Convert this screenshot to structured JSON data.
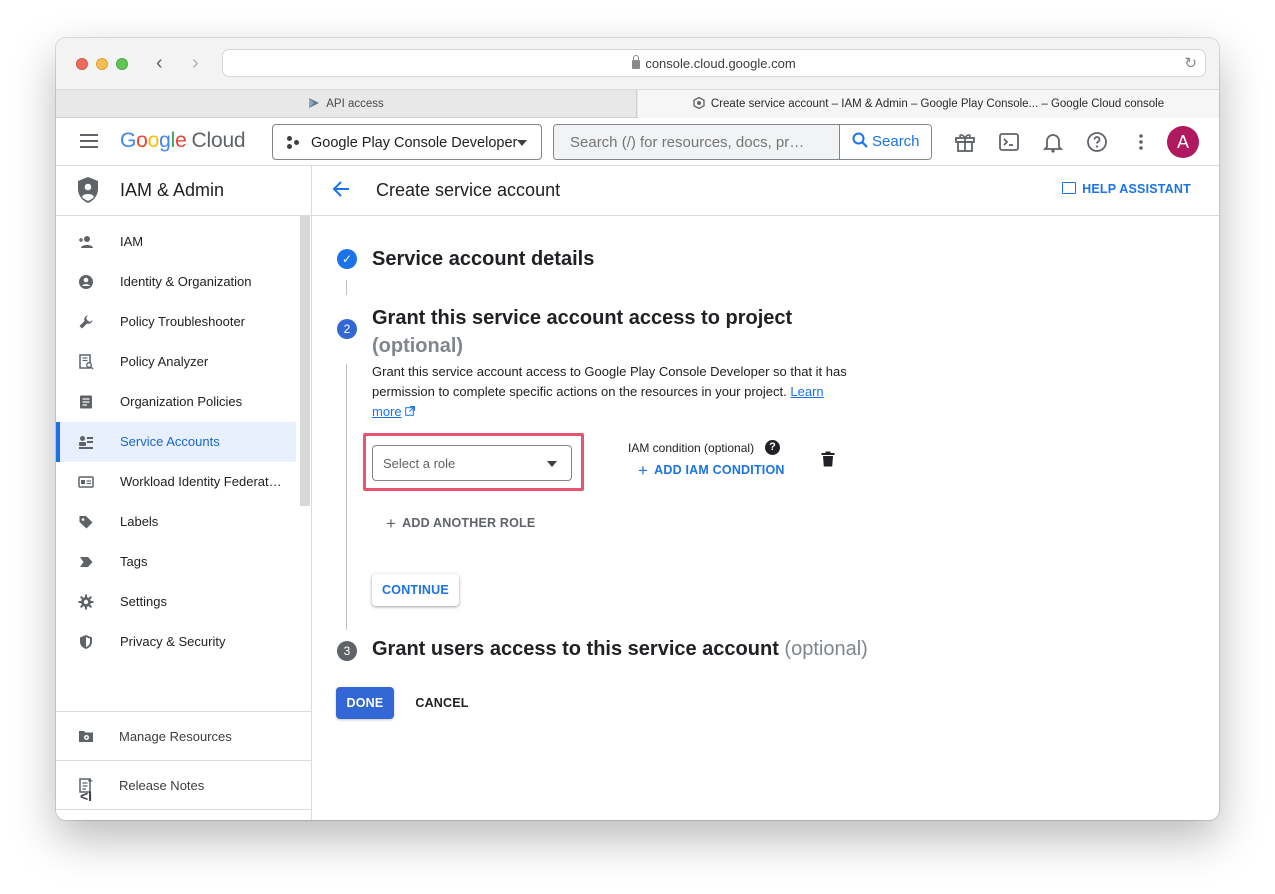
{
  "browser": {
    "url": "console.cloud.google.com",
    "tabs": [
      {
        "label": "API access"
      },
      {
        "label": "Create service account – IAM & Admin – Google Play Console... – Google Cloud console"
      }
    ]
  },
  "header": {
    "logo_google": [
      "G",
      "o",
      "o",
      "g",
      "l",
      "e"
    ],
    "logo_cloud": "Cloud",
    "project": "Google Play Console Developer",
    "search_placeholder": "Search (/) for resources, docs, pr…",
    "search_button": "Search",
    "avatar_initial": "A"
  },
  "sidebar": {
    "title": "IAM & Admin",
    "items": [
      {
        "label": "IAM",
        "icon": "person-add-icon"
      },
      {
        "label": "Identity & Organization",
        "icon": "account-circle-icon"
      },
      {
        "label": "Policy Troubleshooter",
        "icon": "wrench-icon"
      },
      {
        "label": "Policy Analyzer",
        "icon": "document-search-icon"
      },
      {
        "label": "Organization Policies",
        "icon": "list-document-icon"
      },
      {
        "label": "Service Accounts",
        "icon": "service-account-icon",
        "active": true
      },
      {
        "label": "Workload Identity Federat…",
        "icon": "id-card-icon"
      },
      {
        "label": "Labels",
        "icon": "label-icon"
      },
      {
        "label": "Tags",
        "icon": "tag-icon"
      },
      {
        "label": "Settings",
        "icon": "gear-icon"
      },
      {
        "label": "Privacy & Security",
        "icon": "shield-icon"
      }
    ],
    "footer": [
      {
        "label": "Manage Resources",
        "icon": "manage-resources-icon"
      },
      {
        "label": "Release Notes",
        "icon": "release-notes-icon"
      }
    ],
    "collapse_glyph": "<I"
  },
  "main": {
    "title": "Create service account",
    "help_assistant": "HELP ASSISTANT",
    "steps": [
      {
        "number": "✓",
        "title": "Service account details",
        "optional": ""
      },
      {
        "number": "2",
        "title": "Grant this service account access to project",
        "optional": "(optional)"
      },
      {
        "number": "3",
        "title": "Grant users access to this service account",
        "optional": "(optional)"
      }
    ],
    "description": "Grant this service account access to Google Play Console Developer so that it has permission to complete specific actions on the resources in your project.",
    "learn_more": "Learn more",
    "role_placeholder": "Select a role",
    "iam_condition_label": "IAM condition (optional)",
    "add_iam_condition": "ADD IAM CONDITION",
    "add_another_role": "ADD ANOTHER ROLE",
    "continue": "CONTINUE",
    "done": "DONE",
    "cancel": "CANCEL"
  },
  "colors": {
    "accent": "#1a73e8",
    "done_button": "#3367d6",
    "highlight": "#ea5473",
    "avatar": "#b0195e"
  }
}
